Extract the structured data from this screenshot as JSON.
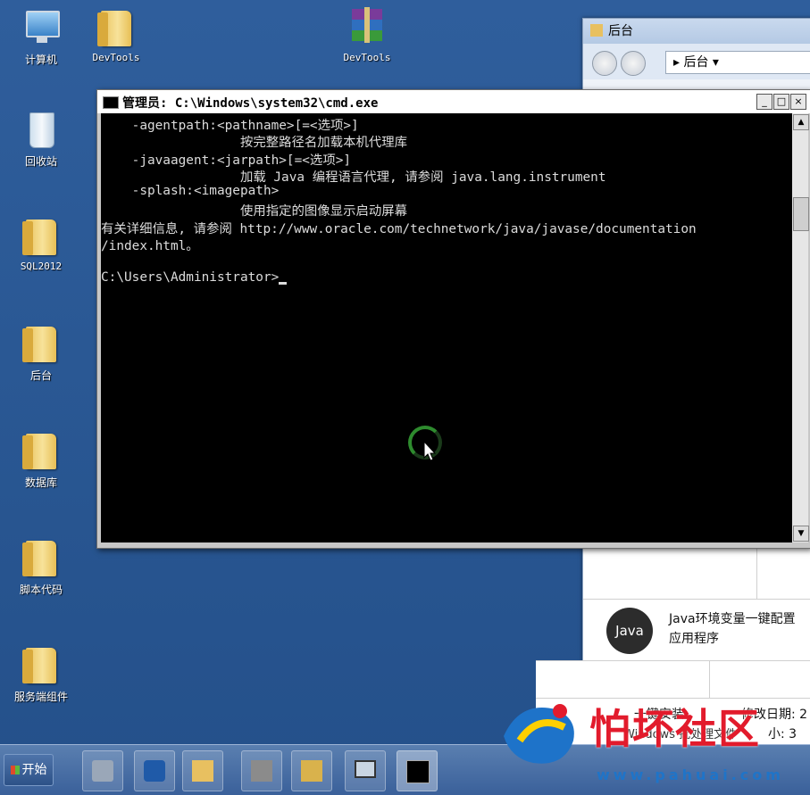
{
  "desktop": {
    "icons": [
      {
        "label": "计算机"
      },
      {
        "label": "DevTools"
      },
      {
        "label": "DevTools"
      },
      {
        "label": "回收站"
      },
      {
        "label": "SQL2012"
      },
      {
        "label": "后台"
      },
      {
        "label": "数据库"
      },
      {
        "label": "脚本代码"
      },
      {
        "label": "服务端组件"
      }
    ]
  },
  "explorer": {
    "title": "后台",
    "breadcrumb": "▸ 后台 ▾",
    "java_badge": "Java",
    "java_line1": "Java环境变量一键配置",
    "java_line2": "应用程序"
  },
  "lower_panel": {
    "item_name": "一键安装",
    "item_type": "Windows 批处理文件",
    "date_label": "修改日期: 2",
    "size_label": "小: 3"
  },
  "cmd": {
    "title": "管理员: C:\\Windows\\system32\\cmd.exe",
    "lines": [
      "    -agentpath:<pathname>[=<选项>]",
      "                  按完整路径名加载本机代理库",
      "    -javaagent:<jarpath>[=<选项>]",
      "                  加载 Java 编程语言代理, 请参阅 java.lang.instrument",
      "    -splash:<imagepath>",
      "                  使用指定的图像显示启动屏幕",
      "有关详细信息, 请参阅 http://www.oracle.com/technetwork/java/javase/documentation",
      "/index.html。",
      "",
      "C:\\Users\\Administrator>"
    ],
    "min_label": "_",
    "max_label": "□",
    "close_label": "×"
  },
  "taskbar": {
    "start_label": "开始"
  },
  "watermark": {
    "name": "怕坏社区",
    "url": "www.pahuai.com"
  }
}
